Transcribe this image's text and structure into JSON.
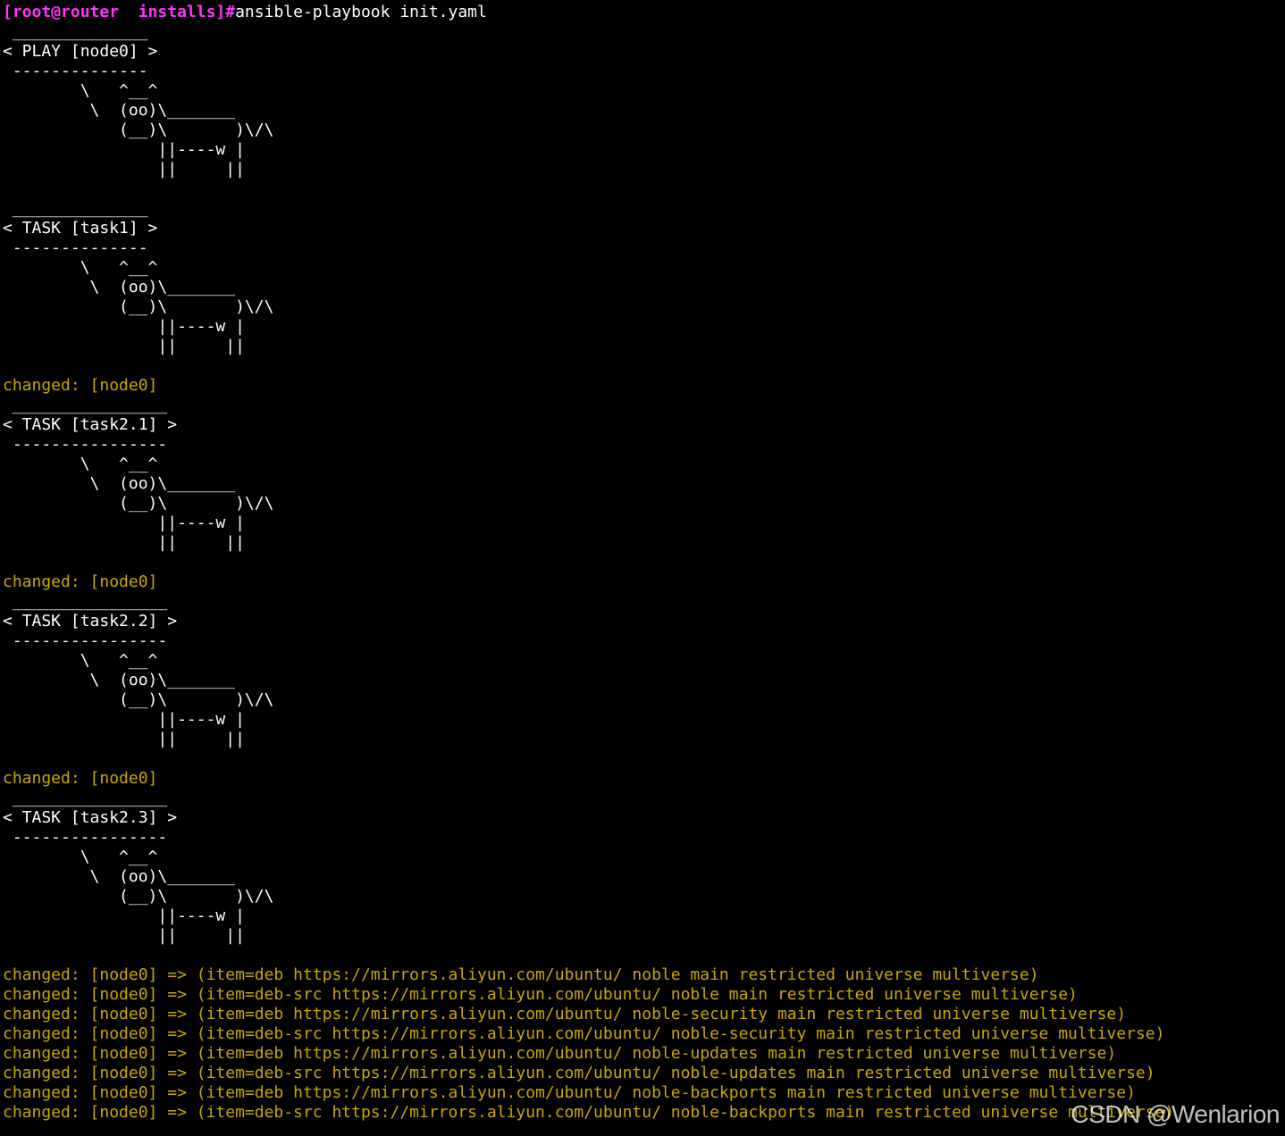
{
  "prompt": "[root@router  installs]#",
  "command": "ansible-playbook init.yaml",
  "cow_lines": [
    "        \\   ^__^",
    "         \\  (oo)\\_______",
    "            (__)\\       )\\/\\",
    "                ||----w |",
    "                ||     ||"
  ],
  "blocks": [
    {
      "top": " ______________",
      "label": "< PLAY [node0] >",
      "bottom": " --------------",
      "results": []
    },
    {
      "top": " ______________",
      "label": "< TASK [task1] >",
      "bottom": " --------------",
      "results": [
        "changed: [node0]"
      ]
    },
    {
      "top": " ________________",
      "label": "< TASK [task2.1] >",
      "bottom": " ----------------",
      "results": [
        "changed: [node0]"
      ]
    },
    {
      "top": " ________________",
      "label": "< TASK [task2.2] >",
      "bottom": " ----------------",
      "results": [
        "changed: [node0]"
      ]
    },
    {
      "top": " ________________",
      "label": "< TASK [task2.3] >",
      "bottom": " ----------------",
      "results": [
        "changed: [node0] => (item=deb https://mirrors.aliyun.com/ubuntu/ noble main restricted universe multiverse)",
        "changed: [node0] => (item=deb-src https://mirrors.aliyun.com/ubuntu/ noble main restricted universe multiverse)",
        "changed: [node0] => (item=deb https://mirrors.aliyun.com/ubuntu/ noble-security main restricted universe multiverse)",
        "changed: [node0] => (item=deb-src https://mirrors.aliyun.com/ubuntu/ noble-security main restricted universe multiverse)",
        "changed: [node0] => (item=deb https://mirrors.aliyun.com/ubuntu/ noble-updates main restricted universe multiverse)",
        "changed: [node0] => (item=deb-src https://mirrors.aliyun.com/ubuntu/ noble-updates main restricted universe multiverse)",
        "changed: [node0] => (item=deb https://mirrors.aliyun.com/ubuntu/ noble-backports main restricted universe multiverse)",
        "changed: [node0] => (item=deb-src https://mirrors.aliyun.com/ubuntu/ noble-backports main restricted universe multiverse)"
      ]
    }
  ],
  "watermark": "CSDN @Wenlarion",
  "colors": {
    "background": "#000000",
    "prompt": "#ff33ff",
    "text": "#ffffff",
    "changed": "#c8a800"
  }
}
